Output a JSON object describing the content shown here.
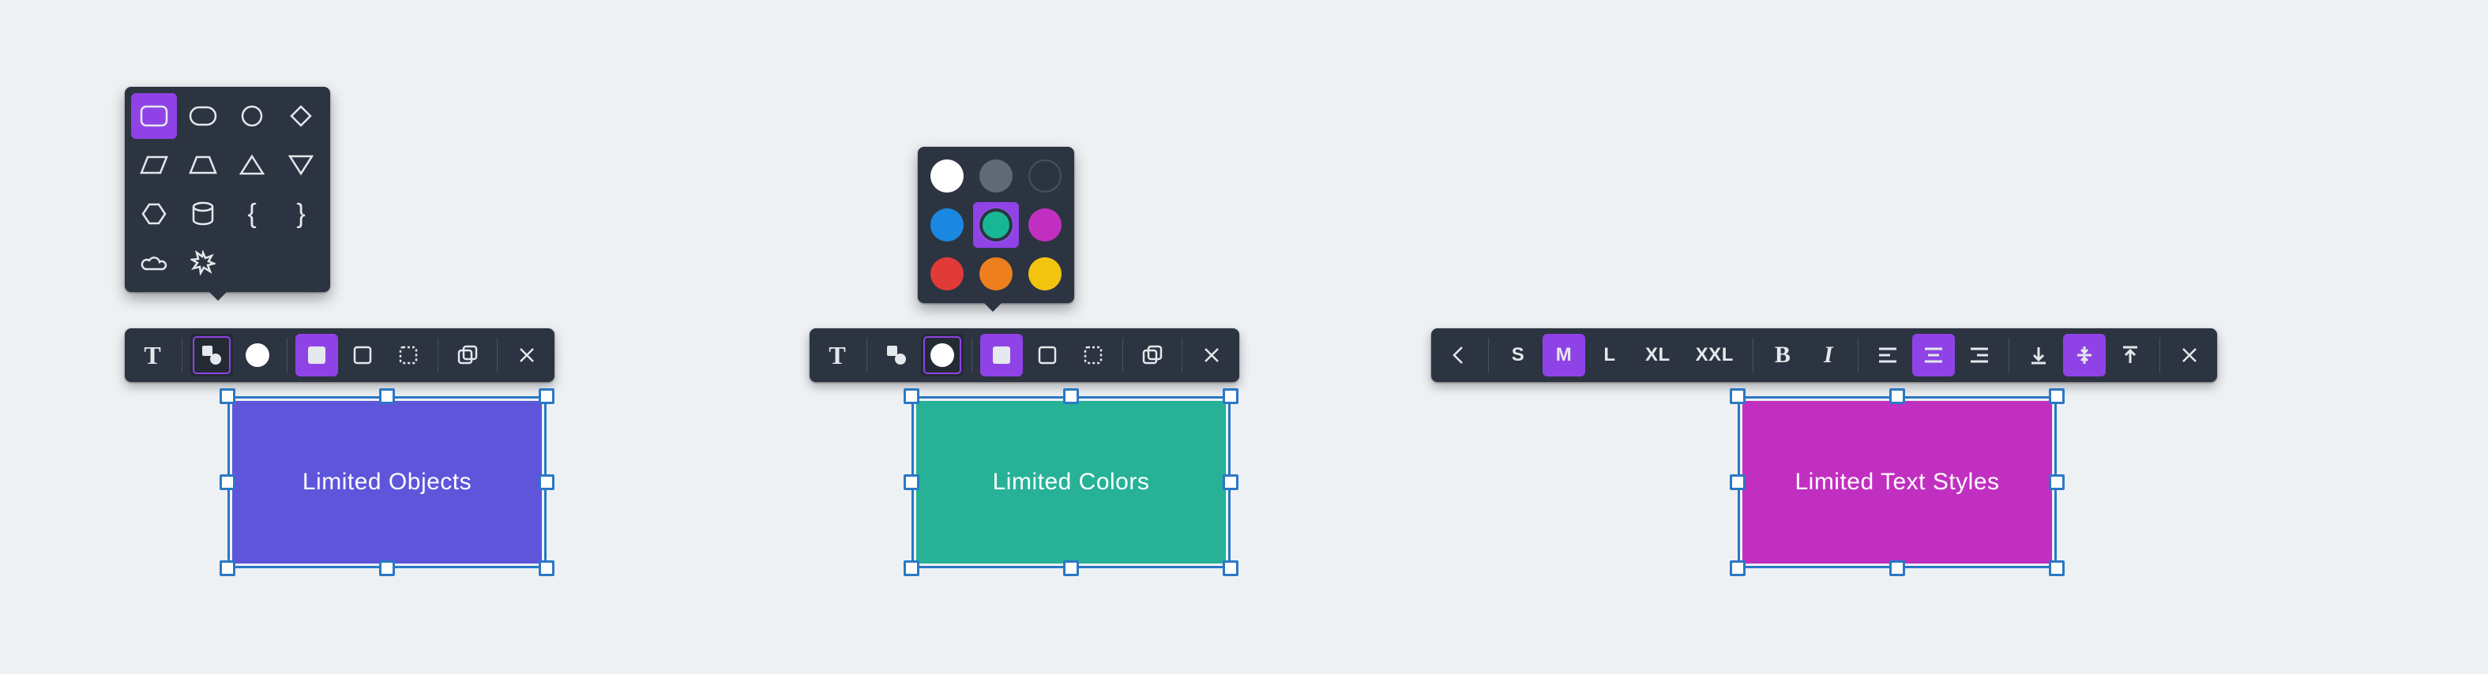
{
  "panels": {
    "objects": {
      "box_label": "Limited Objects",
      "box_color": "#5e55db",
      "toolbar": {
        "text_label": "T",
        "shapes_btn": "shapes",
        "color_btn": "color",
        "fill_btn": "fill",
        "stroke_btn": "stroke",
        "dashed_btn": "dashed",
        "copy_btn": "copy",
        "delete_btn": "delete"
      },
      "shapes": [
        "rounded-rect",
        "capsule",
        "circle",
        "diamond",
        "parallelogram",
        "trapezoid",
        "triangle",
        "inverted-triangle",
        "hexagon",
        "cylinder",
        "brace-left",
        "brace-right",
        "cloud",
        "burst"
      ],
      "selected_shape": "rounded-rect"
    },
    "colors": {
      "box_label": "Limited Colors",
      "box_color": "#27b298",
      "swatches": [
        "#ffffff",
        "#5f6a76",
        "#2b3440",
        "#1a88e0",
        "#17b796",
        "#c12fc1",
        "#e03b38",
        "#ee7f1e",
        "#f3c40f"
      ],
      "selected_swatch": 4
    },
    "text": {
      "box_label": "Limited Text Styles",
      "box_color": "#c12fc1",
      "sizes": [
        "S",
        "M",
        "L",
        "XL",
        "XXL"
      ],
      "selected_size": 1,
      "bold": "B",
      "italic": "I",
      "align": [
        "left",
        "center",
        "right"
      ],
      "selected_align": 1,
      "valign": [
        "bottom",
        "middle",
        "top"
      ],
      "selected_valign": 1
    }
  }
}
